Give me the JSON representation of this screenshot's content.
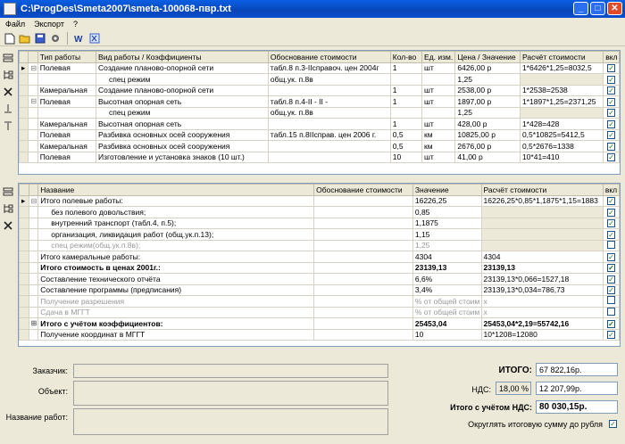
{
  "window": {
    "title": "C:\\ProgDes\\Smeta2007\\smeta-100068-пвр.txt",
    "minimize": "_",
    "maximize": "□",
    "close": "✕"
  },
  "menu": [
    "Файл",
    "Экспорт",
    "?"
  ],
  "top_table": {
    "headers": [
      "Тип работы",
      "Вид работы / Коэффициенты",
      "Обоснование стоимости",
      "Кол-во",
      "Ед. изм.",
      "Цена / Значение",
      "Расчёт стоимости",
      "вкл"
    ],
    "rows": [
      {
        "tree": "⊟",
        "type": "Полевая",
        "work": "Создание планово-опорной сети",
        "basis": "табл.8 п.3-IIсправоч. цен 2004г",
        "qty": "1",
        "unit": "шт",
        "price": "6426,00 р",
        "calc": "1*6426*1,25=8032,5",
        "on": true,
        "sub": false
      },
      {
        "tree": "",
        "type": "",
        "work": "спец режим",
        "basis": "общ.ук. п.8в",
        "qty": "",
        "unit": "",
        "price": "1,25",
        "calc": "",
        "on": true,
        "sub": true
      },
      {
        "tree": "",
        "type": "Камеральная",
        "work": "Создание планово-опорной сети",
        "basis": "",
        "qty": "1",
        "unit": "шт",
        "price": "2538,00 р",
        "calc": "1*2538=2538",
        "on": true,
        "sub": false
      },
      {
        "tree": "⊟",
        "type": "Полевая",
        "work": "Высотная опорная сеть",
        "basis": "табл.8 п.4-II - II -",
        "qty": "1",
        "unit": "шт",
        "price": "1897,00 р",
        "calc": "1*1897*1,25=2371,25",
        "on": true,
        "sub": false
      },
      {
        "tree": "",
        "type": "",
        "work": "спец режим",
        "basis": "общ.ук. п.8в",
        "qty": "",
        "unit": "",
        "price": "1,25",
        "calc": "",
        "on": true,
        "sub": true
      },
      {
        "tree": "",
        "type": "Камеральная",
        "work": "Высотная опорная сеть",
        "basis": "",
        "qty": "1",
        "unit": "шт",
        "price": "428,00 р",
        "calc": "1*428=428",
        "on": true,
        "sub": false
      },
      {
        "tree": "",
        "type": "Полевая",
        "work": "Разбивка основных осей сооружения",
        "basis": "табл.15 п.8IIсправ. цен 2006 г.",
        "qty": "0,5",
        "unit": "км",
        "price": "10825,00 р",
        "calc": "0,5*10825=5412,5",
        "on": true,
        "sub": false
      },
      {
        "tree": "",
        "type": "Камеральная",
        "work": "Разбивка основных осей сооружения",
        "basis": "",
        "qty": "0,5",
        "unit": "км",
        "price": "2676,00 р",
        "calc": "0,5*2676=1338",
        "on": true,
        "sub": false
      },
      {
        "tree": "",
        "type": "Полевая",
        "work": "Изготовление и установка знаков (10 шт.)",
        "basis": "",
        "qty": "10",
        "unit": "шт",
        "price": "41,00 р",
        "calc": "10*41=410",
        "on": true,
        "sub": false
      }
    ]
  },
  "bottom_table": {
    "headers": [
      "Название",
      "Обоснование стоимости",
      "Значение",
      "Расчёт стоимости",
      "вкл"
    ],
    "rows": [
      {
        "tree": "⊟",
        "name": "Итого полевые работы:",
        "basis": "",
        "value": "16226,25",
        "calc": "16226,25*0,85*1,1875*1,15=1883",
        "on": true,
        "style": "",
        "indent": 0
      },
      {
        "tree": "",
        "name": "без полевого довольствия;",
        "basis": "",
        "value": "0,85",
        "calc": "",
        "on": true,
        "style": "",
        "indent": 1
      },
      {
        "tree": "",
        "name": "внутренний транспорт (табл.4, п.5);",
        "basis": "",
        "value": "1,1875",
        "calc": "",
        "on": true,
        "style": "",
        "indent": 1
      },
      {
        "tree": "",
        "name": "организация, ликвидация работ (общ.ук.п.13);",
        "basis": "",
        "value": "1,15",
        "calc": "",
        "on": true,
        "style": "",
        "indent": 1
      },
      {
        "tree": "",
        "name": "спец режим(общ.ук.п.8в);",
        "basis": "",
        "value": "1,25",
        "calc": "",
        "on": false,
        "style": "dim",
        "indent": 1
      },
      {
        "tree": "",
        "name": "Итого камеральные работы:",
        "basis": "",
        "value": "4304",
        "calc": "4304",
        "on": true,
        "style": "",
        "indent": 0
      },
      {
        "tree": "",
        "name": "Итого стоимость в ценах 2001г.:",
        "basis": "",
        "value": "23139,13",
        "calc": "23139,13",
        "on": true,
        "style": "bold",
        "indent": 0
      },
      {
        "tree": "",
        "name": "Составление технического отчёта",
        "basis": "",
        "value": "6,6%",
        "calc": "23139,13*0,066=1527,18",
        "on": true,
        "style": "",
        "indent": 0
      },
      {
        "tree": "",
        "name": "Составление программы (предписания)",
        "basis": "",
        "value": "3,4%",
        "calc": "23139,13*0,034=786,73",
        "on": true,
        "style": "",
        "indent": 0
      },
      {
        "tree": "",
        "name": "Получение разрешения",
        "basis": "",
        "value": "% от общей стоим",
        "calc": "x",
        "on": false,
        "style": "dim",
        "indent": 0
      },
      {
        "tree": "",
        "name": "Сдача в МГГТ",
        "basis": "",
        "value": "% от общей стоим",
        "calc": "x",
        "on": false,
        "style": "dim",
        "indent": 0
      },
      {
        "tree": "⊞",
        "name": "Итого с учётом коэффициентов:",
        "basis": "",
        "value": "25453,04",
        "calc": "25453,04*2,19=55742,16",
        "on": true,
        "style": "bold",
        "indent": 0
      },
      {
        "tree": "",
        "name": "Получение координат в МГГТ",
        "basis": "",
        "value": "10",
        "calc": "10*1208=12080",
        "on": true,
        "style": "",
        "indent": 0
      }
    ]
  },
  "form": {
    "customer_label": "Заказчик:",
    "object_label": "Объект:",
    "work_name_label": "Название работ:",
    "total_label": "ИТОГО:",
    "total_value": "67 822,16р.",
    "vat_label": "НДС:",
    "vat_rate": "18,00 %",
    "vat_value": "12 207,99р.",
    "total_vat_label": "Итого с учётом НДС:",
    "total_vat_value": "80 030,15р.",
    "round_label": "Округлять итоговую сумму до рубля"
  }
}
